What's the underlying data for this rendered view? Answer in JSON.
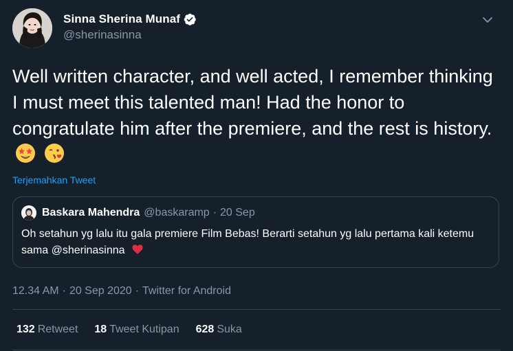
{
  "author": {
    "display_name": "Sinna Sherina Munaf",
    "handle": "@sherinasinna",
    "verified": true
  },
  "tweet": {
    "text_main": "Well written character, and well acted, I remember thinking I must meet this talented man! Had the honor to congratulate him after the premiere, and the rest is history.",
    "emojis": [
      "star-struck-emoji",
      "face-blowing-kiss-emoji"
    ]
  },
  "translate_label": "Terjemahkan Tweet",
  "quote": {
    "display_name": "Baskara Mahendra",
    "handle": "@baskaramp",
    "separator": "·",
    "date": "20 Sep",
    "text": "Oh setahun yg lalu itu gala premiere Film Bebas! Berarti setahun yg lalu pertama kali ketemu sama @sherinasinna",
    "emoji": "red-heart-emoji"
  },
  "meta": {
    "time": "12.34 AM",
    "separator": "·",
    "date": "20 Sep 2020",
    "source": "Twitter for Android"
  },
  "stats": {
    "retweets_count": "132",
    "retweets_label": "Retweet",
    "quotes_count": "18",
    "quotes_label": "Tweet Kutipan",
    "likes_count": "628",
    "likes_label": "Suka"
  },
  "colors": {
    "background": "#15202b",
    "accent": "#1da1f2",
    "secondary_text": "#8899a6",
    "border": "#38444d"
  }
}
